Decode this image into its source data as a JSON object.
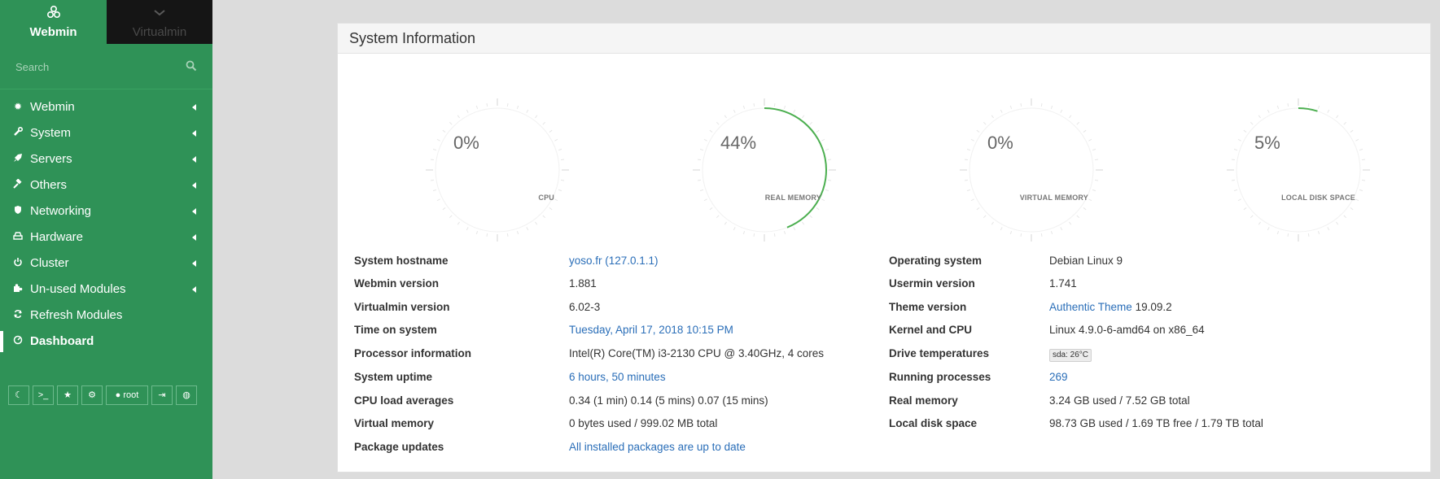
{
  "sidebar": {
    "tabs": [
      {
        "label": "Webmin",
        "icon": "webmin-logo-icon"
      },
      {
        "label": "Virtualmin",
        "icon": "chevron-down-icon"
      }
    ],
    "search_placeholder": "Search",
    "menu": [
      {
        "label": "Webmin",
        "icon": "gear-icon"
      },
      {
        "label": "System",
        "icon": "wrench-icon"
      },
      {
        "label": "Servers",
        "icon": "rocket-icon"
      },
      {
        "label": "Others",
        "icon": "gavel-icon"
      },
      {
        "label": "Networking",
        "icon": "shield-icon"
      },
      {
        "label": "Hardware",
        "icon": "hdd-icon"
      },
      {
        "label": "Cluster",
        "icon": "power-icon"
      },
      {
        "label": "Un-used Modules",
        "icon": "puzzle-icon"
      },
      {
        "label": "Refresh Modules",
        "icon": "refresh-icon"
      },
      {
        "label": "Dashboard",
        "icon": "dashboard-icon"
      }
    ],
    "bottom_user": "root",
    "bottom_buttons": [
      "moon-icon",
      "terminal-icon",
      "star-icon",
      "cogs-icon",
      "user-icon",
      "logout-icon",
      "globe-icon"
    ]
  },
  "panel": {
    "title": "System Information",
    "gauges": [
      {
        "value": "0%",
        "label": "CPU",
        "percent": 0
      },
      {
        "value": "44%",
        "label": "REAL MEMORY",
        "percent": 44
      },
      {
        "value": "0%",
        "label": "VIRTUAL MEMORY",
        "percent": 0
      },
      {
        "value": "5%",
        "label": "LOCAL DISK SPACE",
        "percent": 5
      }
    ],
    "left_rows": [
      {
        "label": "System hostname",
        "value": "yoso.fr (127.0.1.1)",
        "link": true
      },
      {
        "label": "Webmin version",
        "value": "1.881"
      },
      {
        "label": "Virtualmin version",
        "value": "6.02-3"
      },
      {
        "label": "Time on system",
        "value": "Tuesday, April 17, 2018 10:15 PM",
        "link": true
      },
      {
        "label": "Processor information",
        "value": "Intel(R) Core(TM) i3-2130 CPU @ 3.40GHz, 4 cores"
      },
      {
        "label": "System uptime",
        "value": "6 hours, 50 minutes",
        "link": true
      },
      {
        "label": "CPU load averages",
        "value": "0.34 (1 min) 0.14 (5 mins) 0.07 (15 mins)"
      },
      {
        "label": "Virtual memory",
        "value": "0 bytes used / 999.02 MB total"
      },
      {
        "label": "Package updates",
        "value": "All installed packages are up to date",
        "link": true
      }
    ],
    "right_rows": [
      {
        "label": "Operating system",
        "value": "Debian Linux 9"
      },
      {
        "label": "Usermin version",
        "value": "1.741"
      },
      {
        "label": "Theme version",
        "value_link": "Authentic Theme",
        "value": " 19.09.2"
      },
      {
        "label": "Kernel and CPU",
        "value": "Linux 4.9.0-6-amd64 on x86_64"
      },
      {
        "label": "Drive temperatures",
        "value": "sda: 26°C",
        "badge": true
      },
      {
        "label": "Running processes",
        "value": "269",
        "link": true
      },
      {
        "label": "Real memory",
        "value": "3.24 GB used / 7.52 GB total"
      },
      {
        "label": "Local disk space",
        "value": "98.73 GB used / 1.69 TB free / 1.79 TB total"
      }
    ]
  },
  "colors": {
    "sidebar_bg": "#2f9257",
    "gauge_arc": "#4caf50",
    "link": "#2a6eb8"
  }
}
